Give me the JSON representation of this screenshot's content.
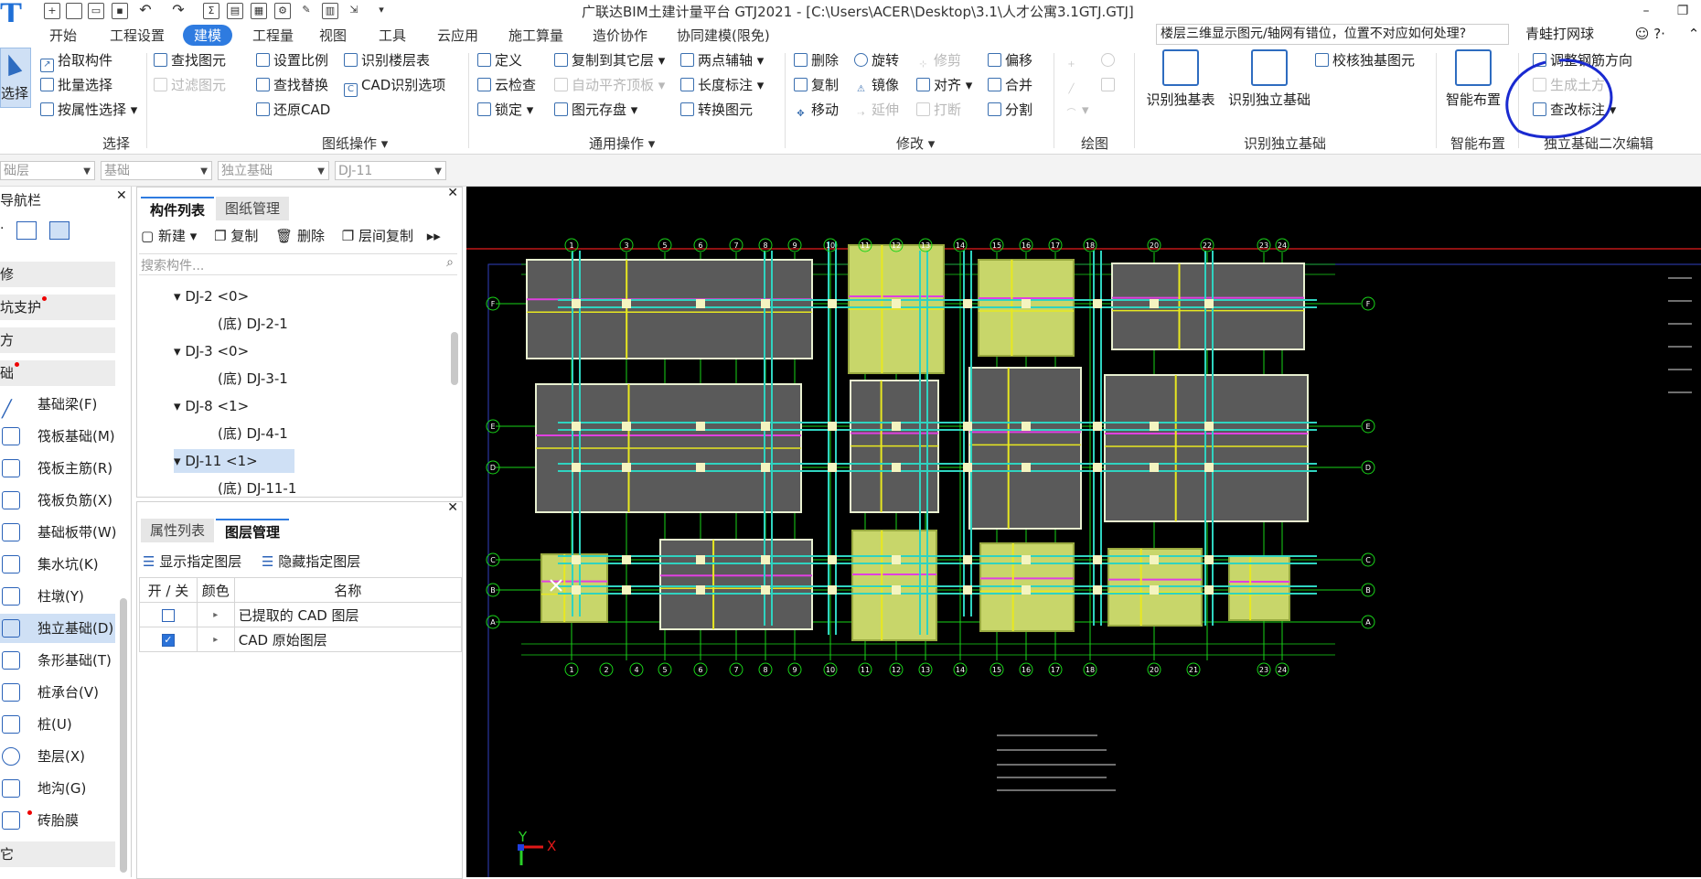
{
  "titlebar": {
    "title": "广联达BIM土建计量平台 GTJ2021 - [C:\\Users\\ACER\\Desktop\\3.1\\人才公寓3.1GTJ.GTJ]",
    "logo": "T",
    "quick_access_icons": [
      "new-file-icon",
      "open-folder-icon",
      "save-icon",
      "undo-icon",
      "redo-icon",
      "sum-icon",
      "report-icon",
      "grid-icon",
      "settings-icon",
      "pen-icon",
      "table-icon",
      "export-icon"
    ]
  },
  "menu": {
    "tabs": [
      "开始",
      "工程设置",
      "建模",
      "视图",
      "工具",
      "工程量",
      "云应用",
      "施工算量",
      "造价协作",
      "协同建模(限免)"
    ],
    "active": "建模",
    "help_question": "楼层三维显示图元/轴网有错位，位置不对应如何处理?",
    "user_name": "青蛙打网球",
    "help_symbol": "?·"
  },
  "ribbon": {
    "select": {
      "label": "选择",
      "pick": "拾取构件",
      "batch": "批量选择",
      "by_attr": "按属性选择",
      "group": "选择"
    },
    "drawing_ops": {
      "find_elem": "查找图元",
      "filter_elem": "过滤图元",
      "set_scale": "设置比例",
      "find_replace": "查找替换",
      "restore_cad": "还原CAD",
      "identify_floors": "识别楼层表",
      "cad_options": "CAD识别选项",
      "group": "图纸操作"
    },
    "general_ops": {
      "define": "定义",
      "cloud_check": "云检查",
      "lock": "锁定",
      "copy_to_floor": "复制到其它层",
      "auto_flat": "自动平齐顶板",
      "save_elem": "图元存盘",
      "two_point_axis": "两点辅轴",
      "length_dim": "长度标注",
      "convert_elem": "转换图元",
      "group": "通用操作"
    },
    "modify": {
      "delete": "删除",
      "copy": "复制",
      "move": "移动",
      "rotate": "旋转",
      "mirror": "镜像",
      "extend": "延伸",
      "trim": "修剪",
      "align": "对齐",
      "break": "打断",
      "offset": "偏移",
      "merge": "合并",
      "split": "分割",
      "group": "修改"
    },
    "draw": {
      "group": "绘图"
    },
    "identify": {
      "identify_table": "识别独基表",
      "identify_found": "识别独立基础",
      "check_found": "校核独基图元",
      "group": "识别独立基础"
    },
    "smart": {
      "smart_layout": "智能布置",
      "group": "智能布置"
    },
    "secondary": {
      "adjust_rebar": "调整钢筋方向",
      "gen_soil": "生成土方",
      "modify_mark": "查改标注",
      "group": "独立基础二次编辑"
    }
  },
  "filterbar": {
    "floor": "础层",
    "category": "基础",
    "type": "独立基础",
    "component": "DJ-11"
  },
  "leftnav": {
    "title": "导航栏",
    "sections": [
      "修",
      "坑支护",
      "方",
      "础"
    ],
    "items": [
      {
        "label": "基础梁(F)",
        "icon": "foundation-beam-icon"
      },
      {
        "label": "筏板基础(M)",
        "icon": "raft-foundation-icon"
      },
      {
        "label": "筏板主筋(R)",
        "icon": "raft-main-rebar-icon"
      },
      {
        "label": "筏板负筋(X)",
        "icon": "raft-neg-rebar-icon"
      },
      {
        "label": "基础板带(W)",
        "icon": "foundation-strip-icon"
      },
      {
        "label": "集水坑(K)",
        "icon": "sump-pit-icon"
      },
      {
        "label": "柱墩(Y)",
        "icon": "column-pier-icon"
      },
      {
        "label": "独立基础(D)",
        "icon": "isolated-foundation-icon"
      },
      {
        "label": "条形基础(T)",
        "icon": "strip-foundation-icon"
      },
      {
        "label": "桩承台(V)",
        "icon": "pile-cap-icon"
      },
      {
        "label": "桩(U)",
        "icon": "pile-icon"
      },
      {
        "label": "垫层(X)",
        "icon": "cushion-icon"
      },
      {
        "label": "地沟(G)",
        "icon": "trench-icon"
      },
      {
        "label": "砖胎膜",
        "icon": "brick-mold-icon"
      }
    ],
    "selected": "独立基础(D)",
    "other_section": "它"
  },
  "comp_panel": {
    "tabs": [
      "构件列表",
      "图纸管理"
    ],
    "toolbar": {
      "new": "新建",
      "copy": "复制",
      "delete": "删除",
      "floor_copy": "层间复制"
    },
    "search_placeholder": "搜索构件...",
    "tree": [
      {
        "label": "DJ-2 <0>",
        "child": "(底) DJ-2-1"
      },
      {
        "label": "DJ-3 <0>",
        "child": "(底) DJ-3-1"
      },
      {
        "label": "DJ-8 <1>",
        "child": "(底) DJ-4-1"
      },
      {
        "label": "DJ-11 <1>",
        "child": "(底) DJ-11-1"
      }
    ]
  },
  "layer_panel": {
    "tabs": [
      "属性列表",
      "图层管理"
    ],
    "show_layer": "显示指定图层",
    "hide_layer": "隐藏指定图层",
    "headers": [
      "开 / 关",
      "颜色",
      "名称"
    ],
    "rows": [
      {
        "checked": false,
        "name": "已提取的 CAD 图层"
      },
      {
        "checked": true,
        "name": "CAD 原始图层"
      }
    ]
  },
  "canvas": {
    "axis_top": [
      "1",
      "3",
      "5",
      "6",
      "7",
      "8",
      "9",
      "10",
      "11",
      "12",
      "13",
      "14",
      "15",
      "16",
      "17",
      "18",
      "20",
      "22",
      "23",
      "24"
    ],
    "axis_bottom": [
      "1",
      "2",
      "4",
      "5",
      "6",
      "7",
      "8",
      "9",
      "10",
      "11",
      "12",
      "13",
      "14",
      "15",
      "16",
      "17",
      "18",
      "20",
      "21",
      "23",
      "24"
    ],
    "axis_left": [
      "F",
      "E",
      "D",
      "C",
      "B",
      "A"
    ],
    "ucs": {
      "x": "X",
      "y": "Y"
    },
    "colors": {
      "background": "#000000",
      "axis": "#19d419",
      "slab_gray": "#5a5a5a",
      "slab_yellow": "#c8d66a",
      "beam_cyan": "#2fd3c0",
      "rebar_magenta": "#e040e0",
      "rebar_yellow": "#e8e820",
      "outline_white": "#e8f0d0",
      "annotation_circle": "#1a2ad0"
    }
  }
}
